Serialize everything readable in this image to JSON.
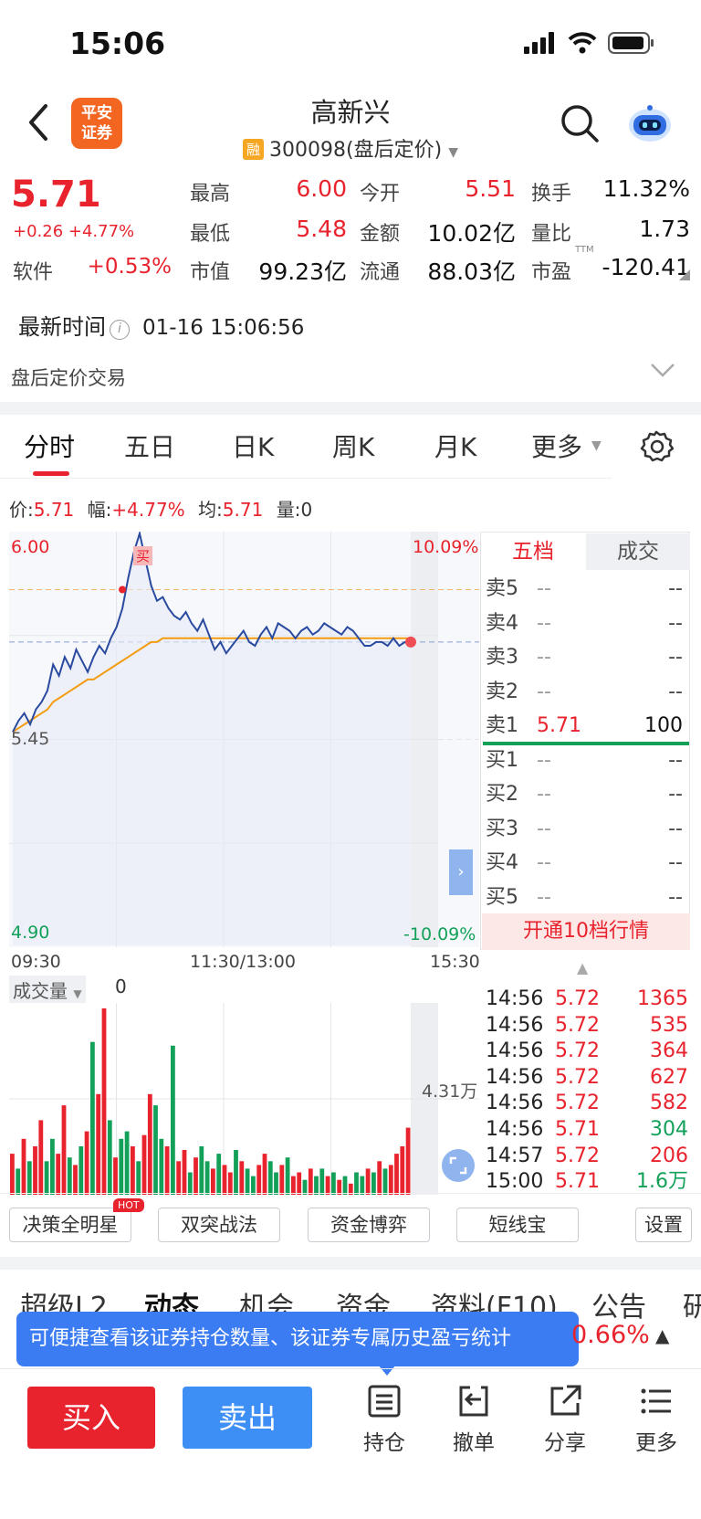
{
  "status_bar": {
    "time": "15:06"
  },
  "nav": {
    "logo_line1": "平安",
    "logo_line2": "证券",
    "title": "高新兴",
    "rong": "融",
    "subtitle": "300098(盘后定价)"
  },
  "quote": {
    "price": "5.71",
    "change": "+0.26 +4.77%",
    "sector_name": "软件",
    "sector_change": "+0.53%",
    "fields": [
      {
        "label": "最高",
        "value": "6.00",
        "color": "red"
      },
      {
        "label": "今开",
        "value": "5.51",
        "color": "red"
      },
      {
        "label": "换手",
        "value": "11.32%",
        "color": "dark"
      },
      {
        "label": "最低",
        "value": "5.48",
        "color": "red"
      },
      {
        "label": "金额",
        "value": "10.02亿",
        "color": "dark"
      },
      {
        "label": "量比",
        "value": "1.73",
        "color": "dark"
      },
      {
        "label": "市值",
        "value": "99.23亿",
        "color": "dark"
      },
      {
        "label": "流通",
        "value": "88.03亿",
        "color": "dark"
      },
      {
        "label": "市盈",
        "value": "-120.41",
        "color": "dark"
      }
    ],
    "ttm_label": "TTM",
    "latest_label": "最新时间",
    "latest_time": "01-16 15:06:56",
    "after_hours_label": "盘后定价交易"
  },
  "kline_tabs": [
    "分时",
    "五日",
    "日K",
    "周K",
    "月K",
    "更多"
  ],
  "info_line": {
    "price_label": "价:",
    "price": "5.71",
    "amp_label": "幅:",
    "amp": "+4.77%",
    "avg_label": "均:",
    "avg": "5.71",
    "vol_label": "量:",
    "vol": "0"
  },
  "chart_data": {
    "type": "line",
    "y_top_label": "6.00",
    "y_mid_label": "5.45",
    "y_bottom_label": "4.90",
    "pct_top_label": "10.09%",
    "pct_bottom_label": "-10.09%",
    "ylim": [
      4.9,
      6.0
    ],
    "prev_close": 5.45,
    "x_labels": [
      "09:30",
      "11:30/13:00",
      "15:30"
    ],
    "buy_marker": "买",
    "price_series": [
      5.47,
      5.5,
      5.52,
      5.49,
      5.53,
      5.55,
      5.58,
      5.65,
      5.62,
      5.67,
      5.64,
      5.69,
      5.66,
      5.63,
      5.67,
      5.7,
      5.68,
      5.72,
      5.75,
      5.8,
      5.88,
      5.95,
      6.0,
      5.93,
      5.86,
      5.82,
      5.83,
      5.8,
      5.78,
      5.77,
      5.79,
      5.76,
      5.74,
      5.77,
      5.73,
      5.69,
      5.71,
      5.68,
      5.7,
      5.72,
      5.74,
      5.71,
      5.7,
      5.73,
      5.75,
      5.72,
      5.76,
      5.75,
      5.74,
      5.72,
      5.74,
      5.75,
      5.73,
      5.74,
      5.76,
      5.75,
      5.74,
      5.73,
      5.75,
      5.74,
      5.72,
      5.7,
      5.7,
      5.71,
      5.71,
      5.7,
      5.72,
      5.7,
      5.71,
      5.71
    ],
    "avg_series": [
      5.47,
      5.48,
      5.49,
      5.5,
      5.51,
      5.52,
      5.53,
      5.55,
      5.56,
      5.57,
      5.58,
      5.59,
      5.6,
      5.61,
      5.61,
      5.62,
      5.63,
      5.64,
      5.65,
      5.66,
      5.67,
      5.68,
      5.69,
      5.7,
      5.71,
      5.71,
      5.72,
      5.72,
      5.72,
      5.72,
      5.72,
      5.72,
      5.72,
      5.72,
      5.72,
      5.72,
      5.72,
      5.72,
      5.72,
      5.72,
      5.72,
      5.72,
      5.72,
      5.72,
      5.72,
      5.72,
      5.72,
      5.72,
      5.72,
      5.72,
      5.72,
      5.72,
      5.72,
      5.72,
      5.72,
      5.72,
      5.72,
      5.72,
      5.72,
      5.72,
      5.72,
      5.72,
      5.72,
      5.72,
      5.72,
      5.72,
      5.72,
      5.72,
      5.72,
      5.72
    ],
    "volume_title": "成交量",
    "volume_value": "0",
    "volume_scale_label": "4.31万",
    "volume_series": [
      22,
      14,
      30,
      18,
      26,
      40,
      18,
      30,
      22,
      48,
      20,
      16,
      26,
      34,
      82,
      54,
      100,
      40,
      20,
      30,
      34,
      26,
      18,
      32,
      54,
      48,
      30,
      26,
      80,
      18,
      24,
      12,
      20,
      26,
      18,
      14,
      22,
      16,
      12,
      24,
      18,
      14,
      10,
      16,
      22,
      18,
      12,
      16,
      20,
      10,
      12,
      8,
      14,
      10,
      14,
      10,
      12,
      8,
      10,
      6,
      12,
      10,
      14,
      12,
      18,
      14,
      16,
      22,
      26,
      36
    ],
    "volume_colors": "rgrgrrggrrgrgrgrrgrggrgrrggrgrrgrggrgrrgrggrrggrgrrgrggrgrgrggrgrgrr"
  },
  "order_book": {
    "tab_five": "五档",
    "tab_deal": "成交",
    "rows": [
      {
        "label": "卖5",
        "price": "--",
        "vol": "--"
      },
      {
        "label": "卖4",
        "price": "--",
        "vol": "--"
      },
      {
        "label": "卖3",
        "price": "--",
        "vol": "--"
      },
      {
        "label": "卖2",
        "price": "--",
        "vol": "--"
      },
      {
        "label": "卖1",
        "price": "5.71",
        "vol": "100"
      },
      {
        "label": "买1",
        "price": "--",
        "vol": "--"
      },
      {
        "label": "买2",
        "price": "--",
        "vol": "--"
      },
      {
        "label": "买3",
        "price": "--",
        "vol": "--"
      },
      {
        "label": "买4",
        "price": "--",
        "vol": "--"
      },
      {
        "label": "买5",
        "price": "--",
        "vol": "--"
      }
    ],
    "open10": "开通10档行情"
  },
  "trades": [
    {
      "time": "14:56",
      "price": "5.72",
      "vol": "1365",
      "pc": "red",
      "vc": "red"
    },
    {
      "time": "14:56",
      "price": "5.72",
      "vol": "535",
      "pc": "red",
      "vc": "red"
    },
    {
      "time": "14:56",
      "price": "5.72",
      "vol": "364",
      "pc": "red",
      "vc": "red"
    },
    {
      "time": "14:56",
      "price": "5.72",
      "vol": "627",
      "pc": "red",
      "vc": "red"
    },
    {
      "time": "14:56",
      "price": "5.72",
      "vol": "582",
      "pc": "red",
      "vc": "red"
    },
    {
      "time": "14:56",
      "price": "5.71",
      "vol": "304",
      "pc": "red",
      "vc": "green"
    },
    {
      "time": "14:57",
      "price": "5.72",
      "vol": "206",
      "pc": "red",
      "vc": "red"
    },
    {
      "time": "15:00",
      "price": "5.71",
      "vol": "1.6万",
      "pc": "red",
      "vc": "green"
    }
  ],
  "strategies": {
    "items": [
      "决策全明星",
      "双突战法",
      "资金博弈",
      "短线宝"
    ],
    "hot": "HOT",
    "settings": "设置"
  },
  "bottom_tabs": [
    "超级L2",
    "动态",
    "机会",
    "资金",
    "资料(F10)",
    "公告",
    "研"
  ],
  "tooltip": "可便捷查看该证券持仓数量、该证券专属历史盈亏统计",
  "pct_right": "0.66%",
  "toolbar": {
    "buy": "买入",
    "sell": "卖出",
    "hold": "持仓",
    "cancel": "撤单",
    "share": "分享",
    "more": "更多"
  },
  "colors": {
    "red": "#e8232d",
    "green": "#13a15a",
    "blue": "#3e8ff5",
    "avg_line": "#f39c12",
    "price_line": "#2a4aa0"
  }
}
